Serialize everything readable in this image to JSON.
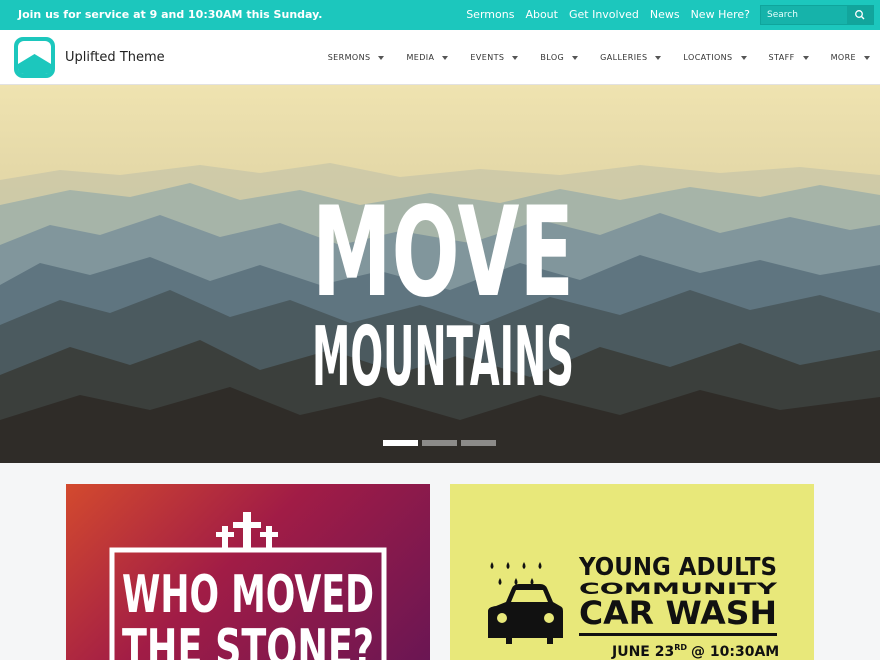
{
  "topbar": {
    "message": "Join us for service at 9 and 10:30AM this Sunday.",
    "links": [
      "Sermons",
      "About",
      "Get Involved",
      "News",
      "New Here?"
    ],
    "search_placeholder": "Search"
  },
  "header": {
    "site_title": "Uplifted Theme",
    "nav": [
      {
        "label": "SERMONS"
      },
      {
        "label": "MEDIA"
      },
      {
        "label": "EVENTS"
      },
      {
        "label": "BLOG"
      },
      {
        "label": "GALLERIES"
      },
      {
        "label": "LOCATIONS"
      },
      {
        "label": "STAFF"
      },
      {
        "label": "MORE"
      }
    ]
  },
  "hero": {
    "line1": "MOVE",
    "line2": "MOUNTAINS",
    "slides_total": 3,
    "active_slide": 1
  },
  "cards": [
    {
      "title_line1": "WHO MOVED",
      "title_line2": "THE STONE?"
    },
    {
      "line1": "YOUNG ADULTS",
      "line2": "COMMUNITY",
      "line3": "CAR WASH",
      "date_prefix": "JUNE 23",
      "date_suffix": "RD",
      "time": "@ 10:30AM"
    }
  ],
  "colors": {
    "accent": "#1cc7bd",
    "card2_bg": "#e8e87a"
  }
}
